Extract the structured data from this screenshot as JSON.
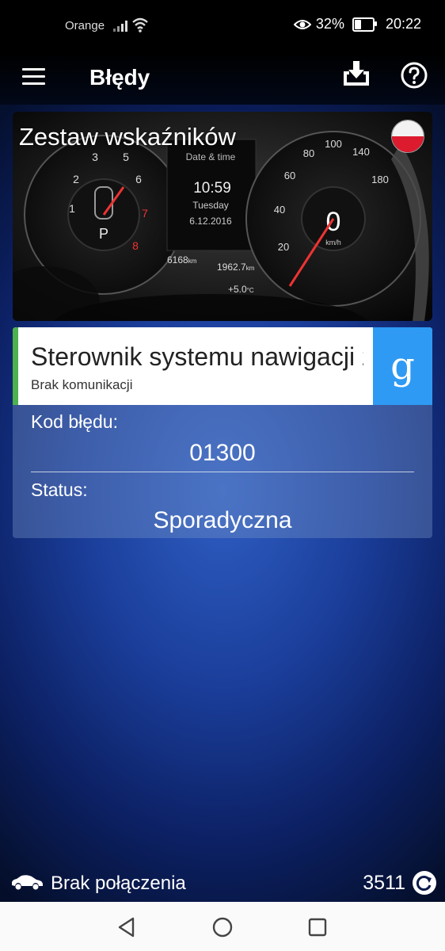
{
  "status_bar": {
    "carrier": "Orange",
    "battery": "32%",
    "battery_level": 0.32,
    "time": "20:22",
    "icons": [
      "signal-icon",
      "wifi-icon",
      "eye-icon",
      "battery-icon"
    ]
  },
  "app_bar": {
    "title": "Błędy",
    "icons": [
      "menu-icon",
      "download-icon",
      "help-icon"
    ]
  },
  "ecu": {
    "title": "Zestaw wskaźników",
    "flag": "poland-flag",
    "cluster": {
      "date_label": "Date & time",
      "time": "10:59",
      "day": "Tuesday",
      "date": "6.12.2016",
      "odometer": "6168",
      "odo_unit": "km",
      "range": "1962.7",
      "range_unit": "km",
      "temp": "+5.0",
      "temp_unit": "°C",
      "speed": "0",
      "speed_unit": "km/h",
      "gear": "P",
      "speed_ticks": [
        "20",
        "40",
        "60",
        "80",
        "100",
        "140",
        "180"
      ],
      "rpm_ticks": [
        "1",
        "2",
        "3",
        "5",
        "6",
        "7",
        "8"
      ]
    }
  },
  "fault": {
    "name": "Sterownik systemu nawigacji z",
    "subtitle": "Brak komunikacji",
    "code_label": "Kod błędu:",
    "code": "01300",
    "status_label": "Status:",
    "status": "Sporadyczna",
    "accent_color": "#4db14d",
    "google_label": "g",
    "google_color": "#2e9af3"
  },
  "bottom": {
    "connection": "Brak połączenia",
    "count": "3511",
    "icons": [
      "car-icon",
      "refresh-icon"
    ]
  },
  "nav_bar": {
    "icons": [
      "back-icon",
      "home-icon",
      "recents-icon"
    ]
  }
}
